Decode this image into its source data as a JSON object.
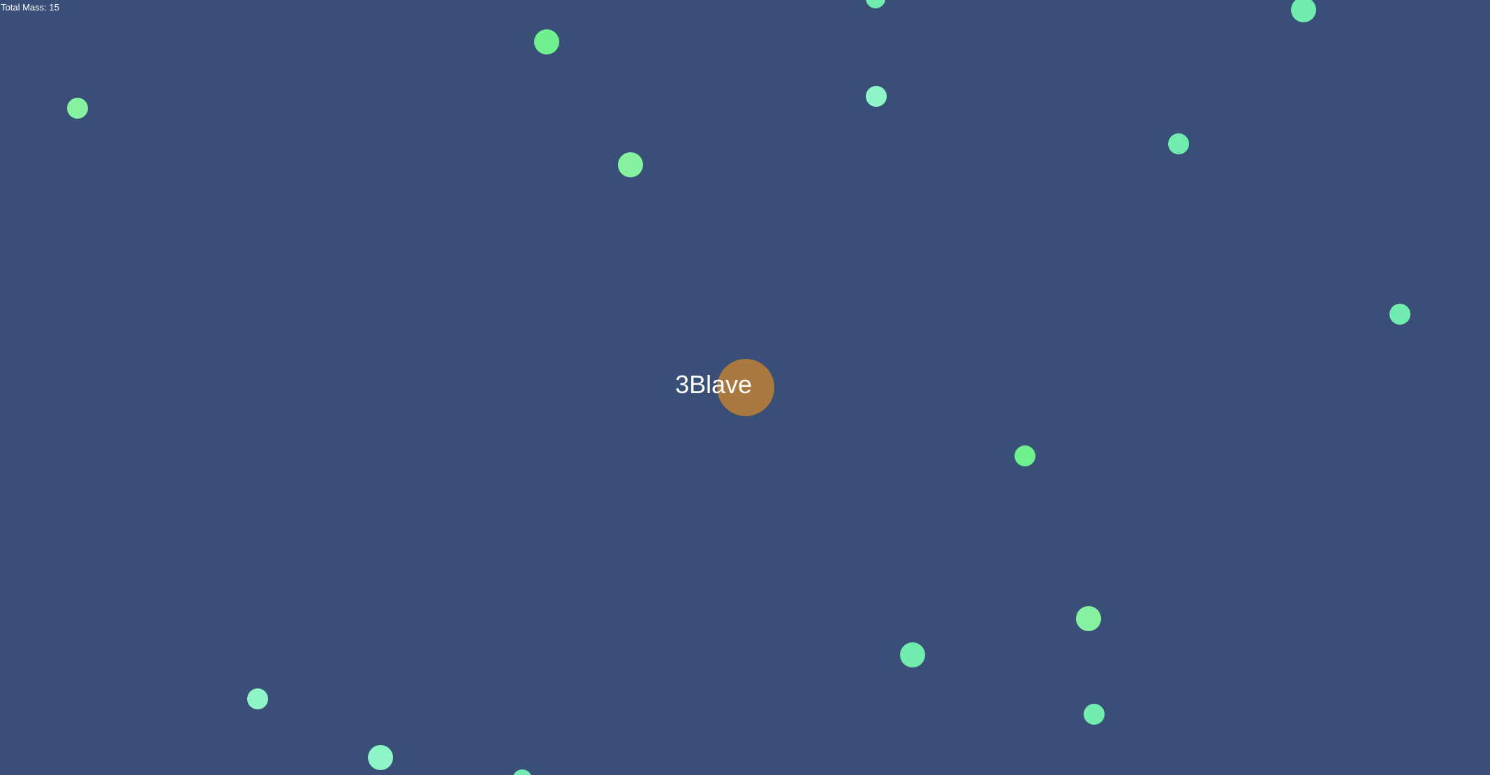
{
  "hud": {
    "total_mass_label": "Total Mass: 15"
  },
  "player": {
    "name": "3Blave",
    "color": "#a9793f"
  },
  "world": {
    "background_color": "#3a4f78"
  },
  "food_palette": [
    "#6ef08f",
    "#84f29e",
    "#72ecae",
    "#8ef5c9"
  ]
}
